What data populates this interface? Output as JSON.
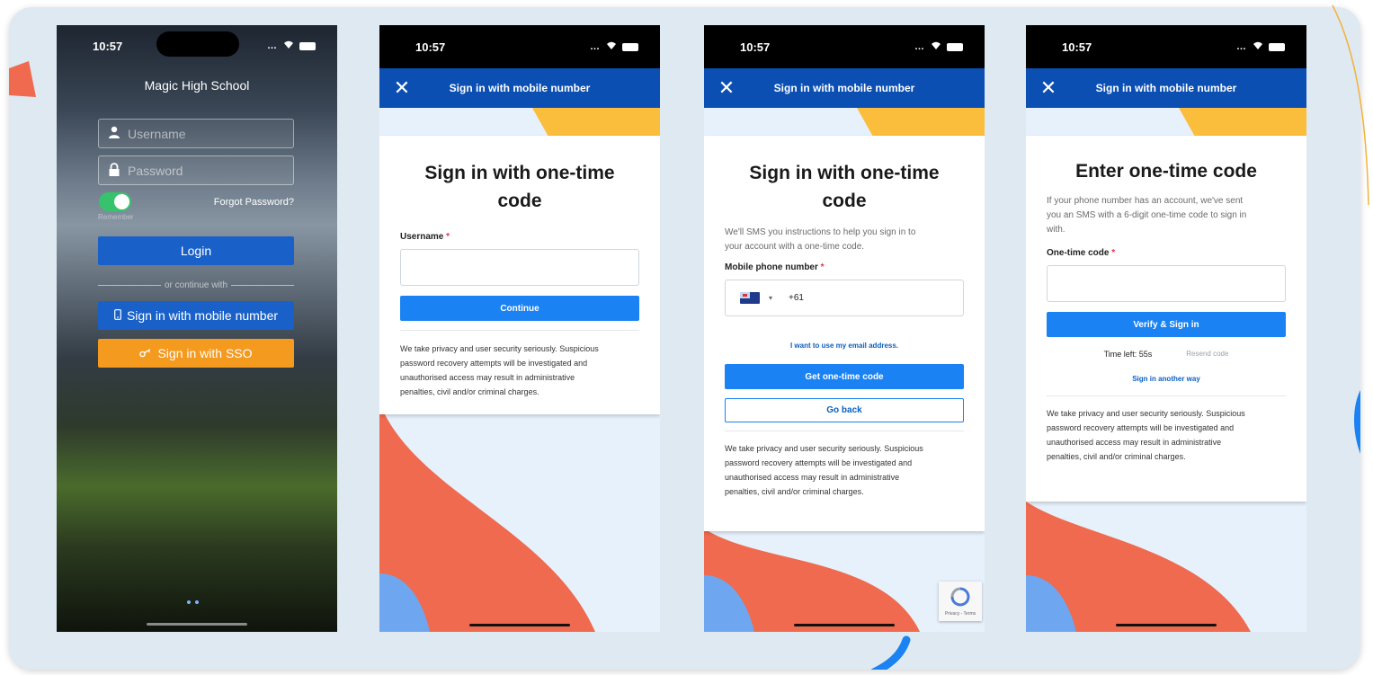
{
  "colors": {
    "brand_blue": "#0b4fb2",
    "button_blue": "#1a82f2",
    "login_blue": "#1961c9",
    "sso_orange": "#f49a1f",
    "toggle_green": "#37c36b",
    "deco_coral": "#ef6a4f",
    "deco_yellow": "#fbbd3c",
    "deco_light_blue": "#6ea7f0",
    "required_red": "#e0334a"
  },
  "status": {
    "time": "10:57"
  },
  "phone1": {
    "school": "Magic High School",
    "username_placeholder": "Username",
    "password_placeholder": "Password",
    "remember": "Remember",
    "forgot": "Forgot Password?",
    "login": "Login",
    "or_continue": "or continue with",
    "mobile_button": "Sign in with mobile number",
    "sso_button": "Sign in with SSO",
    "icons": {
      "user": "user-icon",
      "lock": "lock-icon",
      "phone": "mobile-phone-icon",
      "key": "key-icon"
    }
  },
  "nav": {
    "title": "Sign in with mobile number",
    "close": "✕"
  },
  "phone2": {
    "heading_line1": "Sign in with one-time",
    "heading_line2": "code",
    "username_label": "Username",
    "required": "*",
    "continue": "Continue",
    "privacy_lines": [
      "We take privacy and user security seriously. Suspicious",
      "password recovery attempts will be investigated and",
      "unauthorised access may result in administrative",
      "penalties, civil and/or criminal charges."
    ]
  },
  "phone3": {
    "heading_line1": "Sign in with one-time",
    "heading_line2": "code",
    "desc_line1": "We'll SMS you instructions to help you sign in to",
    "desc_line2": "your account with a one-time code.",
    "mobile_label": "Mobile phone number",
    "country_code": "+61",
    "email_link": "I want to use my email address.",
    "get_code": "Get one-time code",
    "go_back": "Go back",
    "recaptcha_text": "Privacy - Terms"
  },
  "phone4": {
    "heading": "Enter one-time code",
    "desc_lines": [
      "If your phone number has an account, we've sent",
      "you an SMS with a 6-digit one-time code to sign in",
      "with."
    ],
    "code_label": "One-time code",
    "verify": "Verify & Sign in",
    "time_left": "Time left: 55s",
    "resend": "Resend code",
    "another_way": "Sign in another way"
  }
}
